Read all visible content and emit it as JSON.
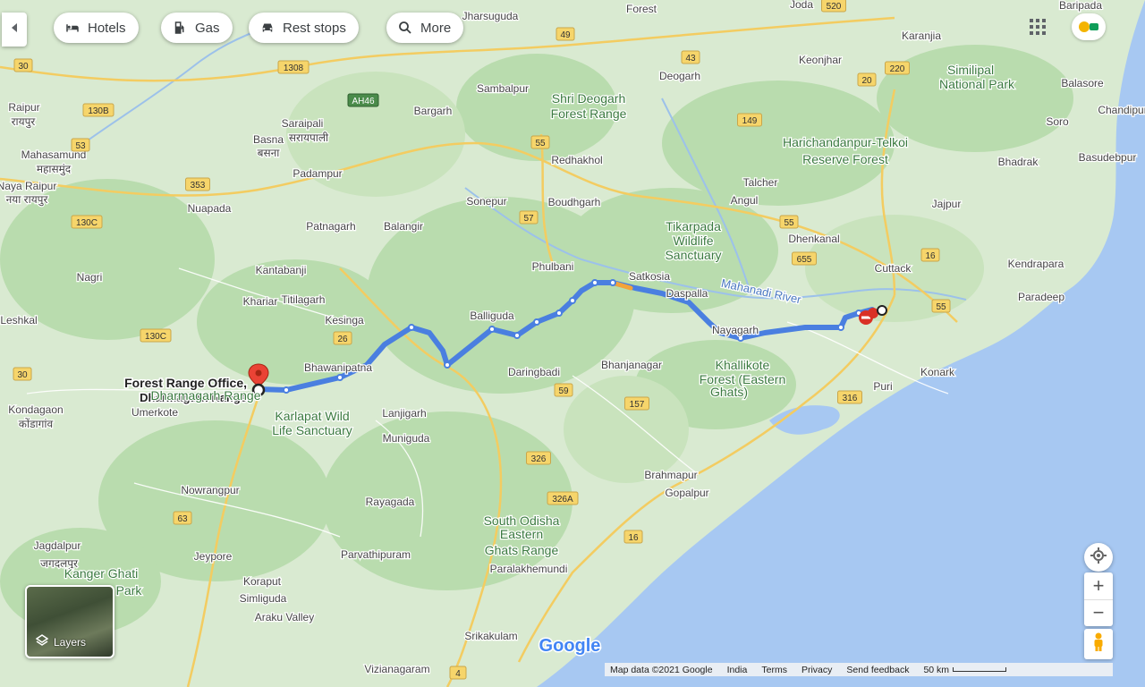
{
  "toolbar": {
    "chips": [
      {
        "label": "Hotels",
        "icon": "bed-icon"
      },
      {
        "label": "Gas",
        "icon": "gas-pump-icon"
      },
      {
        "label": "Rest stops",
        "icon": "car-icon"
      },
      {
        "label": "More",
        "icon": "search-icon"
      }
    ]
  },
  "route": {
    "origin_label_line1": "Forest Range Office,",
    "origin_label_line2": "Dharmagarh Range",
    "color": "#4a7fe0"
  },
  "places": [
    {
      "name": "Raipur"
    },
    {
      "name": "रायपुर"
    },
    {
      "name": "Mahasamund"
    },
    {
      "name": "महासमुंद"
    },
    {
      "name": "Naya Raipur"
    },
    {
      "name": "नया रायपुर"
    },
    {
      "name": "Nuapada"
    },
    {
      "name": "Basna"
    },
    {
      "name": "बसना"
    },
    {
      "name": "Saraipali"
    },
    {
      "name": "सरायपाली"
    },
    {
      "name": "Padampur"
    },
    {
      "name": "Bargarh"
    },
    {
      "name": "Sambalpur"
    },
    {
      "name": "Jharsuguda"
    },
    {
      "name": "Patnagarh"
    },
    {
      "name": "Balangir"
    },
    {
      "name": "Sonepur"
    },
    {
      "name": "Boudhgarh"
    },
    {
      "name": "Redhakhol"
    },
    {
      "name": "Angul"
    },
    {
      "name": "Talcher"
    },
    {
      "name": "Dhenkanal"
    },
    {
      "name": "Cuttack"
    },
    {
      "name": "Kendrapara"
    },
    {
      "name": "Paradeep"
    },
    {
      "name": "Bhadrak"
    },
    {
      "name": "Balasore"
    },
    {
      "name": "Keonjhar"
    },
    {
      "name": "Karanjia"
    },
    {
      "name": "Baripada"
    },
    {
      "name": "Jajpur"
    },
    {
      "name": "Kantabanji"
    },
    {
      "name": "Khariar"
    },
    {
      "name": "Titilagarh"
    },
    {
      "name": "Kesinga"
    },
    {
      "name": "Bhawanipatna"
    },
    {
      "name": "Phulbani"
    },
    {
      "name": "Balliguda"
    },
    {
      "name": "Daringbadi"
    },
    {
      "name": "Bhanjanagar"
    },
    {
      "name": "Satkosia"
    },
    {
      "name": "Daspalla"
    },
    {
      "name": "Nayagarh"
    },
    {
      "name": "Puri"
    },
    {
      "name": "Konark"
    },
    {
      "name": "Brahmapur"
    },
    {
      "name": "Gopalpur"
    },
    {
      "name": "Paralakhemundi"
    },
    {
      "name": "Rayagada"
    },
    {
      "name": "Lanjigarh"
    },
    {
      "name": "Muniguda"
    },
    {
      "name": "Nowrangpur"
    },
    {
      "name": "Jagdalpur"
    },
    {
      "name": "जगदलपुर"
    },
    {
      "name": "Kondagaon"
    },
    {
      "name": "कोंडागांव"
    },
    {
      "name": "Umerkote"
    },
    {
      "name": "Jeypore"
    },
    {
      "name": "Koraput"
    },
    {
      "name": "Parvathipuram"
    },
    {
      "name": "Srikakulam"
    },
    {
      "name": "Vizianagaram"
    },
    {
      "name": "Araku Valley"
    },
    {
      "name": "Simliguda"
    },
    {
      "name": "Nagri"
    },
    {
      "name": "Deogarh"
    },
    {
      "name": "Joda"
    },
    {
      "name": "Soro"
    },
    {
      "name": "Basudebpur"
    },
    {
      "name": "Chandipur"
    },
    {
      "name": "Forest"
    },
    {
      "name": "Dharmagarh Range"
    },
    {
      "name": "Leshkal"
    },
    {
      "name": "Shri Deogarh"
    },
    {
      "name": "Forest Range"
    },
    {
      "name": "Tikarpada"
    },
    {
      "name": "Wildlife"
    },
    {
      "name": "Sanctuary"
    },
    {
      "name": "Similipal"
    },
    {
      "name": "National Park"
    },
    {
      "name": "Harichandanpur-Telkoi"
    },
    {
      "name": "Reserve Forest"
    },
    {
      "name": "Karlapat Wild"
    },
    {
      "name": "Life Sanctuary"
    },
    {
      "name": "Khallikote"
    },
    {
      "name": "Forest (Eastern"
    },
    {
      "name": "Ghats)"
    },
    {
      "name": "South Odisha"
    },
    {
      "name": "Eastern"
    },
    {
      "name": "Ghats Range"
    },
    {
      "name": "Kanger Ghati"
    },
    {
      "name": "Park"
    },
    {
      "name": "Mahanadi River"
    },
    {
      "name": "Mahanadi River"
    }
  ],
  "road_shields": [
    "520",
    "30",
    "1308",
    "130B",
    "53",
    "353",
    "130C",
    "26",
    "AH46",
    "49",
    "43",
    "55",
    "57",
    "59",
    "157",
    "326",
    "326A",
    "16",
    "316",
    "63",
    "220",
    "20",
    "149",
    "55",
    "655",
    "16",
    "55",
    "30",
    "130C",
    "4"
  ],
  "map_controls": {
    "layers_label": "Layers",
    "zoom_in": "+",
    "zoom_out": "−"
  },
  "footer": {
    "map_data": "Map data ©2021 Google",
    "region": "India",
    "terms": "Terms",
    "privacy": "Privacy",
    "feedback": "Send feedback",
    "scale": "50 km"
  },
  "brand": "Google"
}
